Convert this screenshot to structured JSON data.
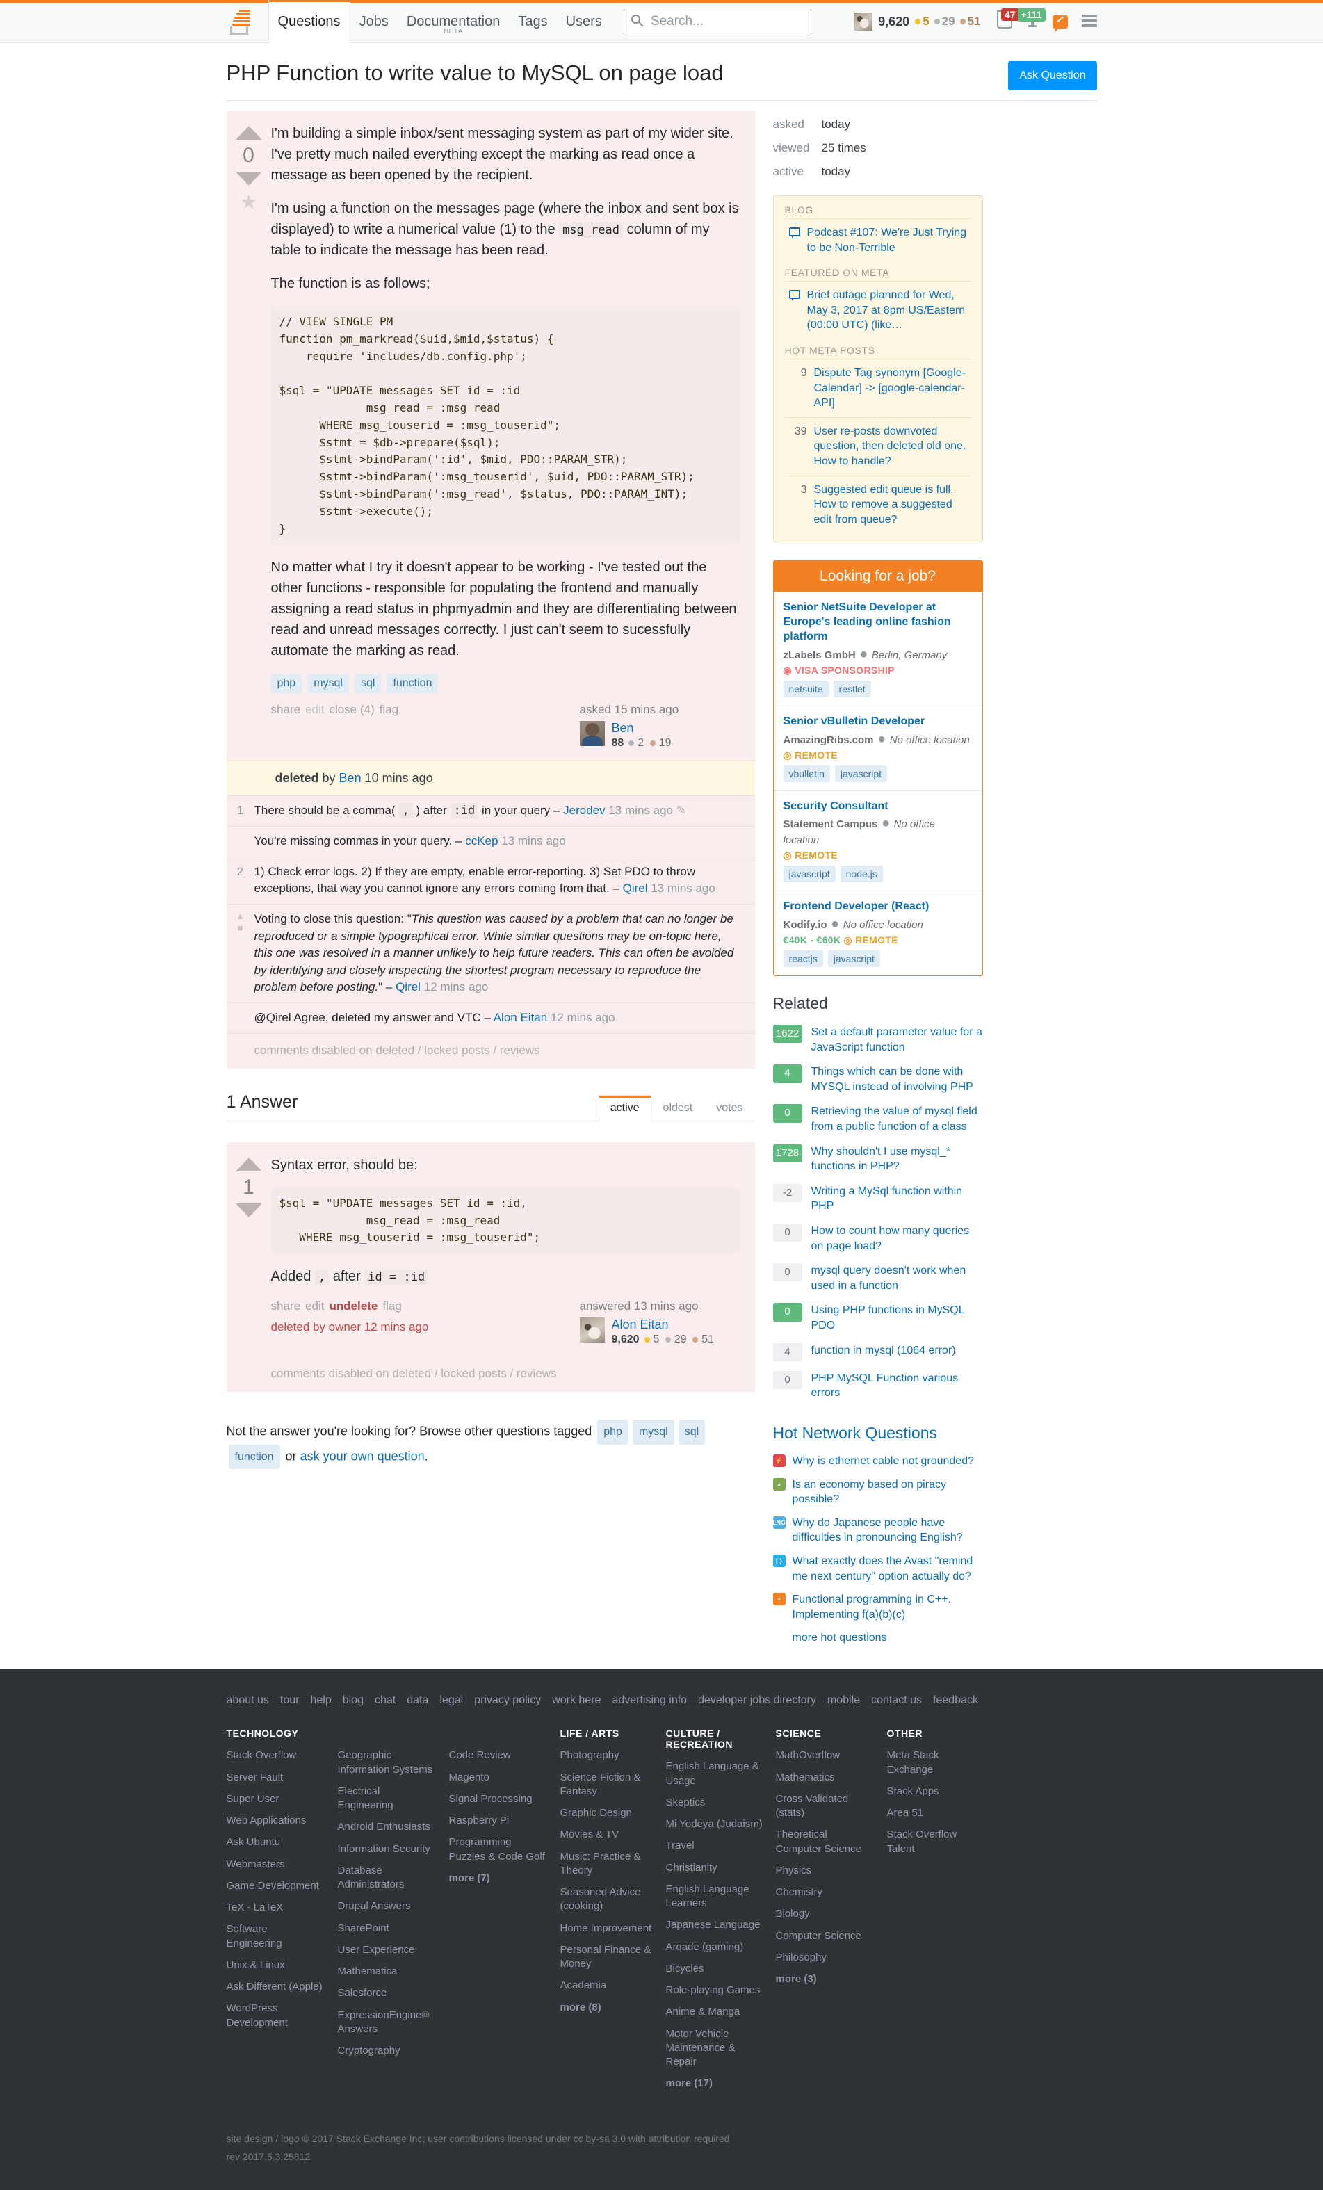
{
  "topnav": {
    "logo_name": "stack-overflow-logo",
    "links": [
      {
        "label": "Questions",
        "active": true
      },
      {
        "label": "Jobs",
        "active": false
      },
      {
        "label": "Documentation",
        "active": false,
        "beta": "BETA"
      },
      {
        "label": "Tags",
        "active": false
      },
      {
        "label": "Users",
        "active": false
      }
    ],
    "search_placeholder": "Search...",
    "search_value": "",
    "reputation": "9,620",
    "badges": {
      "gold": "5",
      "silver": "29",
      "bronze": "51"
    },
    "inbox_count": "47",
    "achievements_count": "+111"
  },
  "header": {
    "title": "PHP Function to write value to MySQL on page load",
    "ask_button": "Ask Question"
  },
  "question": {
    "votes": "0",
    "paragraph1": "I'm building a simple inbox/sent messaging system as part of my wider site. I've pretty much nailed everything except the marking as read once a message as been opened by the recipient.",
    "paragraph2_a": "I'm using a function on the messages page (where the inbox and sent box is displayed) to write a numerical value (1) to the ",
    "paragraph2_code": "msg_read",
    "paragraph2_b": " column of my table to indicate the message has been read.",
    "paragraph3": "The function is as follows;",
    "code": "// VIEW SINGLE PM\nfunction pm_markread($uid,$mid,$status) {\n    require 'includes/db.config.php';\n\n$sql = \"UPDATE messages SET id = :id\n             msg_read = :msg_read\n      WHERE msg_touserid = :msg_touserid\";\n      $stmt = $db->prepare($sql);\n      $stmt->bindParam(':id', $mid, PDO::PARAM_STR);\n      $stmt->bindParam(':msg_touserid', $uid, PDO::PARAM_STR);\n      $stmt->bindParam(':msg_read', $status, PDO::PARAM_INT);\n      $stmt->execute();\n}",
    "paragraph4": "No matter what I try it doesn't appear to be working - I've tested out the other functions - responsible for populating the frontend and manually assigning a read status in phpmyadmin and they are differentiating between read and unread messages correctly. I just can't seem to sucessfully automate the marking as read.",
    "tags": [
      "php",
      "mysql",
      "sql",
      "function"
    ],
    "menu": {
      "share": "share",
      "edit": "edit",
      "close": "close (4)",
      "flag": "flag"
    },
    "asked_when": "asked 15 mins ago",
    "author": "Ben",
    "author_rep": "88",
    "author_silver": "2",
    "author_bronze": "19",
    "deleted_banner": {
      "bold": "deleted",
      "by": " by ",
      "user": "Ben",
      "when": " 10 mins ago"
    },
    "comments_disabled": "comments disabled on deleted / locked posts / reviews"
  },
  "question_comments": [
    {
      "score": "1",
      "text_a": "There should be a comma( ",
      "code1": ",",
      "text_b": " ) after ",
      "code2": ":id",
      "text_c": " in your query ",
      "dash": "– ",
      "user": "Jerodev",
      "time": " 13 mins ago",
      "pencil": "✎"
    },
    {
      "score": "",
      "text_a": "You're missing commas in your query. ",
      "code1": "",
      "text_b": "",
      "code2": "",
      "text_c": "",
      "dash": "– ",
      "user": "ccKep",
      "time": " 13 mins ago",
      "pencil": ""
    },
    {
      "score": "2",
      "text_a": "1) Check error logs. 2) If they are empty, enable error-reporting. 3) Set PDO to throw exceptions, that way you cannot ignore any errors coming from that. ",
      "code1": "",
      "text_b": "",
      "code2": "",
      "text_c": "",
      "dash": "– ",
      "user": "Qirel",
      "time": " 13 mins ago",
      "pencil": ""
    }
  ],
  "close_vote_comment": {
    "lead": "Voting to close this question: \"",
    "quote": "This question was caused by a problem that can no longer be reproduced or a simple typographical error. While similar questions may be on-topic here, this one was resolved in a manner unlikely to help future readers. This can often be avoided by identifying and closely inspecting the shortest program necessary to reproduce the problem before posting.",
    "tail": "\" ",
    "dash": "– ",
    "user": "Qirel",
    "time": " 12 mins ago"
  },
  "last_comment": {
    "text": "@Qirel Agree, deleted my answer and VTC ",
    "dash": "– ",
    "user": "Alon Eitan",
    "time": " 12 mins ago"
  },
  "answers_section": {
    "heading": "1 Answer",
    "tabs": [
      {
        "label": "active",
        "active": true
      },
      {
        "label": "oldest",
        "active": false
      },
      {
        "label": "votes",
        "active": false
      }
    ]
  },
  "answer": {
    "votes": "1",
    "paragraph1": "Syntax error, should be:",
    "code": "$sql = \"UPDATE messages SET id = :id,\n             msg_read = :msg_read\n   WHERE msg_touserid = :msg_touserid\";",
    "added_a": "Added ",
    "added_code1": ",",
    "added_b": " after ",
    "added_code2": "id = :id",
    "menu": {
      "share": "share",
      "edit": "edit",
      "undelete": "undelete",
      "flag": "flag"
    },
    "deleted_note": "deleted by owner 12 mins ago",
    "answered_when": "answered 13 mins ago",
    "author": "Alon Eitan",
    "author_rep": "9,620",
    "author_gold": "5",
    "author_silver": "29",
    "author_bronze": "51",
    "comments_disabled": "comments disabled on deleted / locked posts / reviews"
  },
  "not_answer": {
    "lead": "Not the answer you're looking for? Browse other questions tagged ",
    "tags": [
      "php",
      "mysql",
      "sql",
      "function"
    ],
    "or": " or ",
    "ask_link": "ask your own question",
    "period": "."
  },
  "sidebar": {
    "stats": [
      {
        "key": "asked",
        "value": "today"
      },
      {
        "key": "viewed",
        "value": "25 times"
      },
      {
        "key": "active",
        "value": "today"
      }
    ],
    "blog_heading": "BLOG",
    "blog_items": [
      {
        "title": "Podcast #107: We're Just Trying to be Non-Terrible"
      }
    ],
    "meta_heading": "FEATURED ON META",
    "meta_items": [
      {
        "title": "Brief outage planned for Wed, May 3, 2017 at 8pm US/Eastern (00:00 UTC) (like…"
      }
    ],
    "hot_meta_heading": "HOT META POSTS",
    "hot_meta": [
      {
        "score": "9",
        "title": "Dispute Tag synonym [Google-Calendar] -> [google-calendar-API]"
      },
      {
        "score": "39",
        "title": "User re-posts downvoted question, then deleted old one. How to handle?"
      },
      {
        "score": "3",
        "title": "Suggested edit queue is full. How to remove a suggested edit from queue?"
      }
    ],
    "jobs_title": "Looking for a job?",
    "jobs": [
      {
        "name": "Senior NetSuite Developer at Europe's leading online fashion platform",
        "company": "zLabels GmbH",
        "location": "Berlin, Germany",
        "meta_type": "visa",
        "meta_label": "VISA SPONSORSHIP",
        "salary": "",
        "tags": [
          "netsuite",
          "restlet"
        ]
      },
      {
        "name": "Senior vBulletin Developer",
        "company": "AmazingRibs.com",
        "location": "No office location",
        "meta_type": "remote",
        "meta_label": "REMOTE",
        "salary": "",
        "tags": [
          "vbulletin",
          "javascript"
        ]
      },
      {
        "name": "Security Consultant",
        "company": "Statement Campus",
        "location": "No office location",
        "meta_type": "remote",
        "meta_label": "REMOTE",
        "salary": "",
        "tags": [
          "javascript",
          "node.js"
        ]
      },
      {
        "name": "Frontend Developer (React)",
        "company": "Kodify.io",
        "location": "No office location",
        "meta_type": "remote",
        "meta_label": "REMOTE",
        "salary": "€40K - €60K",
        "tags": [
          "reactjs",
          "javascript"
        ]
      }
    ],
    "related_heading": "Related",
    "related": [
      {
        "score": "1622",
        "hot": true,
        "title": "Set a default parameter value for a JavaScript function"
      },
      {
        "score": "4",
        "hot": true,
        "title": "Things which can be done with MYSQL instead of involving PHP"
      },
      {
        "score": "0",
        "hot": true,
        "title": "Retrieving the value of mysql field from a public function of a class"
      },
      {
        "score": "1728",
        "hot": true,
        "title": "Why shouldn't I use mysql_* functions in PHP?"
      },
      {
        "score": "-2",
        "hot": false,
        "title": "Writing a MySql function within PHP"
      },
      {
        "score": "0",
        "hot": false,
        "title": "How to count how many queries on page load?"
      },
      {
        "score": "0",
        "hot": false,
        "title": "mysql query doesn't work when used in a function"
      },
      {
        "score": "0",
        "hot": true,
        "title": "Using PHP functions in MySQL PDO"
      },
      {
        "score": "4",
        "hot": false,
        "title": "function in mysql (1064 error)"
      },
      {
        "score": "0",
        "hot": false,
        "title": "PHP MySQL Function various errors"
      }
    ],
    "hot_network_heading": "Hot Network Questions",
    "hot_network": [
      {
        "icon": "electronics-icon",
        "color": "#e0474c",
        "glyph": "⚡",
        "title": "Why is ethernet cable not grounded?"
      },
      {
        "icon": "economics-icon",
        "color": "#7fa650",
        "glyph": "◕",
        "title": "Is an economy based on piracy possible?"
      },
      {
        "icon": "linguistics-icon",
        "color": "#4fb0e0",
        "glyph": "LNG",
        "title": "Why do Japanese people have difficulties in pronouncing English?"
      },
      {
        "icon": "superuser-icon",
        "color": "#24b0ec",
        "glyph": "[ }",
        "title": "What exactly does the Avast \"remind me next century\" option actually do?"
      },
      {
        "icon": "stackoverflow-icon",
        "color": "#f48024",
        "glyph": "≡",
        "title": "Functional programming in C++. Implementing f(a)(b)(c)"
      }
    ],
    "more_hot": "more hot questions"
  },
  "footer": {
    "toplinks": [
      "about us",
      "tour",
      "help",
      "blog",
      "chat",
      "data",
      "legal",
      "privacy policy",
      "work here",
      "advertising info",
      "developer jobs directory",
      "mobile",
      "contact us",
      "feedback"
    ],
    "columns": [
      {
        "heading": "TECHNOLOGY",
        "links": [
          "Stack Overflow",
          "Server Fault",
          "Super User",
          "Web Applications",
          "Ask Ubuntu",
          "Webmasters",
          "Game Development",
          "TeX - LaTeX",
          "Software Engineering",
          "Unix & Linux",
          "Ask Different (Apple)",
          "WordPress Development"
        ],
        "more": ""
      },
      {
        "heading": "",
        "links": [
          "Geographic Information Systems",
          "Electrical Engineering",
          "Android Enthusiasts",
          "Information Security",
          "Database Administrators",
          "Drupal Answers",
          "SharePoint",
          "User Experience",
          "Mathematica",
          "Salesforce",
          "ExpressionEngine® Answers",
          "Cryptography"
        ],
        "more": ""
      },
      {
        "heading": "",
        "links": [
          "Code Review",
          "Magento",
          "Signal Processing",
          "Raspberry Pi",
          "Programming Puzzles & Code Golf"
        ],
        "more": "more (7)"
      },
      {
        "heading": "LIFE / ARTS",
        "links": [
          "Photography",
          "Science Fiction & Fantasy",
          "Graphic Design",
          "Movies & TV",
          "Music: Practice & Theory",
          "Seasoned Advice (cooking)",
          "Home Improvement",
          "Personal Finance & Money",
          "Academia"
        ],
        "more": "more (8)"
      },
      {
        "heading": "CULTURE / RECREATION",
        "links": [
          "English Language & Usage",
          "Skeptics",
          "Mi Yodeya (Judaism)",
          "Travel",
          "Christianity",
          "English Language Learners",
          "Japanese Language",
          "Arqade (gaming)",
          "Bicycles",
          "Role-playing Games",
          "Anime & Manga",
          "Motor Vehicle Maintenance & Repair"
        ],
        "more": "more (17)"
      },
      {
        "heading": "SCIENCE",
        "links": [
          "MathOverflow",
          "Mathematics",
          "Cross Validated (stats)",
          "Theoretical Computer Science",
          "Physics",
          "Chemistry",
          "Biology",
          "Computer Science",
          "Philosophy"
        ],
        "more": "more (3)"
      },
      {
        "heading": "OTHER",
        "links": [
          "Meta Stack Exchange",
          "Stack Apps",
          "Area 51",
          "Stack Overflow Talent"
        ],
        "more": ""
      }
    ],
    "legal_a": "site design / logo © 2017 Stack Exchange Inc; user contributions licensed under ",
    "legal_license": "cc by-sa 3.0",
    "legal_b": " with ",
    "legal_attr": "attribution required",
    "rev": "rev 2017.5.3.25812"
  }
}
